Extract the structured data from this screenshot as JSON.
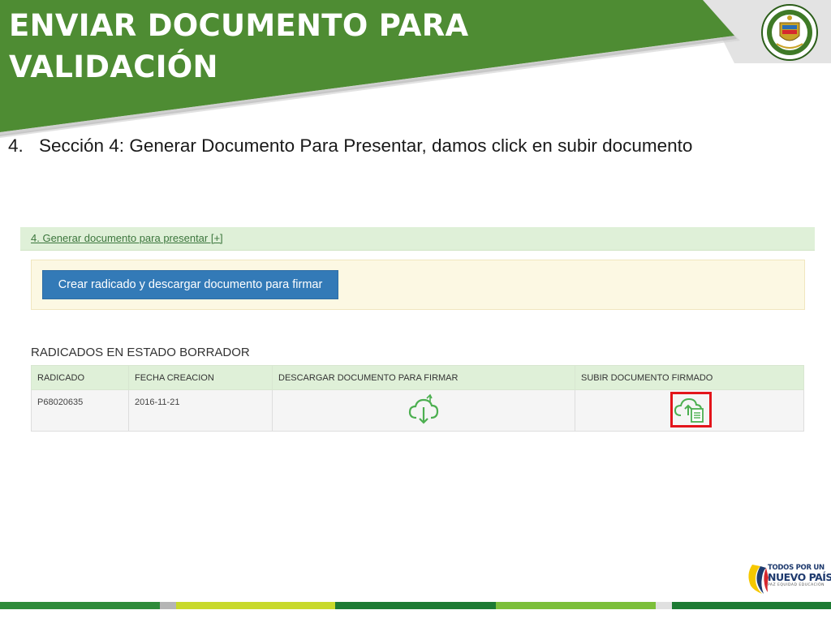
{
  "slide": {
    "title_line1": "ENVIAR DOCUMENTO PARA",
    "title_line2": "VALIDACIÓN",
    "step_number": "4.",
    "step_text": "Sección 4: Generar Documento Para Presentar, damos click en subir documento"
  },
  "panel": {
    "header_link": "4. Generar documento para presentar [+]",
    "create_button": "Crear radicado y descargar documento para firmar",
    "section_title": "RADICADOS EN ESTADO BORRADOR",
    "table": {
      "columns": [
        "RADICADO",
        "FECHA CREACION",
        "DESCARGAR DOCUMENTO PARA FIRMAR",
        "SUBIR DOCUMENTO FIRMADO"
      ],
      "rows": [
        {
          "radicado": "P68020635",
          "fecha": "2016-11-21",
          "download_icon": "cloud-download-icon",
          "upload_icon": "cloud-upload-document-icon"
        }
      ]
    }
  },
  "logo": {
    "line1": "TODOS POR UN",
    "line2": "NUEVO PAÍS",
    "line3": "PAZ  EQUIDAD  EDUCACIÓN"
  },
  "colors": {
    "banner_green": "#4e8c33",
    "header_green": "#dff0d8",
    "action_yellow": "#fcf8e3",
    "button_blue": "#337ab7",
    "icon_green": "#4caf50",
    "highlight_red": "#e3141b"
  }
}
